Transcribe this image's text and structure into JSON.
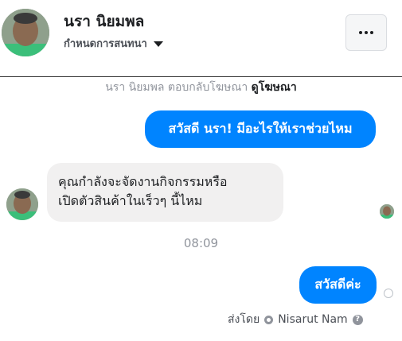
{
  "header": {
    "name": "นรา นิยมพล",
    "subtitle": "กำหนดการสนทนา"
  },
  "ad_note": {
    "text": "นรา นิยมพล ตอบกลับโฆษณา",
    "link": "ดูโฆษณา"
  },
  "messages": {
    "outgoing_1": "สวัสดี นรา! มีอะไรให้เราช่วยไหม",
    "incoming_1_line1": "คุณกำลังจะจัดงานกิจกรรมหรือ",
    "incoming_1_line2": "เปิดตัวสินค้าในเร็วๆ นี้ไหม",
    "timestamp": "08:09",
    "outgoing_2": "สวัสดีค่ะ"
  },
  "footer": {
    "sent_by_label": "ส่งโดย",
    "sender_name": "Nisarut Nam"
  },
  "icons": {
    "more": "more-horizontal-icon",
    "caret": "chevron-down-icon",
    "read": "read-receipt-icon",
    "help": "help-icon"
  },
  "colors": {
    "outgoing_bubble": "#0084ff",
    "incoming_bubble": "#f1f0f0",
    "muted_text": "#90949c"
  }
}
